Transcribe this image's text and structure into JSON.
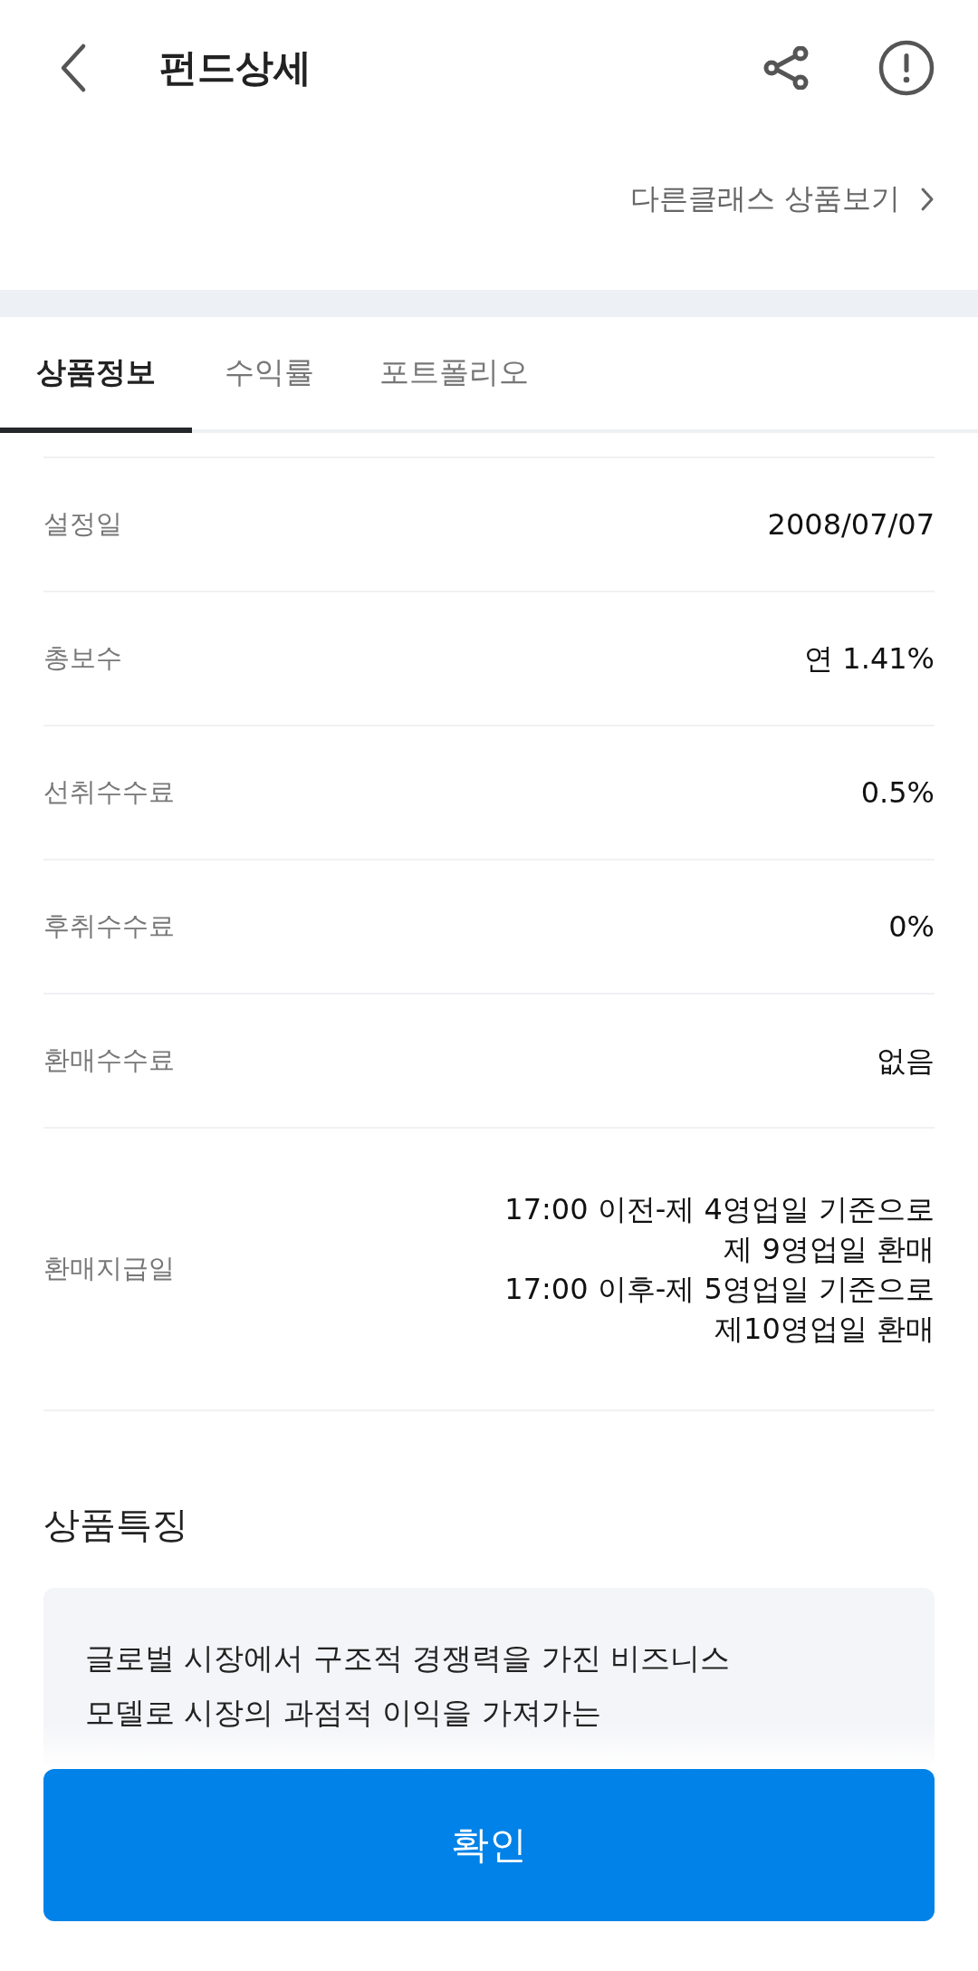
{
  "header": {
    "title": "펀드상세"
  },
  "other_class_link": "다른클래스 상품보기",
  "tabs": [
    {
      "label": "상품정보",
      "selected": true
    },
    {
      "label": "수익률",
      "selected": false
    },
    {
      "label": "포트폴리오",
      "selected": false
    }
  ],
  "info_rows": [
    {
      "label": "설정일",
      "value": [
        "2008/07/07"
      ]
    },
    {
      "label": "총보수",
      "value": [
        "연 1.41%"
      ]
    },
    {
      "label": "선취수수료",
      "value": [
        "0.5%"
      ]
    },
    {
      "label": "후취수수료",
      "value": [
        "0%"
      ]
    },
    {
      "label": "환매수수료",
      "value": [
        "없음"
      ]
    },
    {
      "label": "환매지급일",
      "value": [
        "17:00 이전-제 4영업일 기준으로",
        "제 9영업일 환매",
        "17:00 이후-제 5영업일 기준으로",
        "제10영업일 환매"
      ]
    }
  ],
  "features": {
    "heading": "상품특징",
    "lines": [
      "글로벌 시장에서 구조적 경쟁력을 가진 비즈니스",
      "모델로 시장의 과점적 이익을 가져가는"
    ]
  },
  "confirm_button": "확인"
}
